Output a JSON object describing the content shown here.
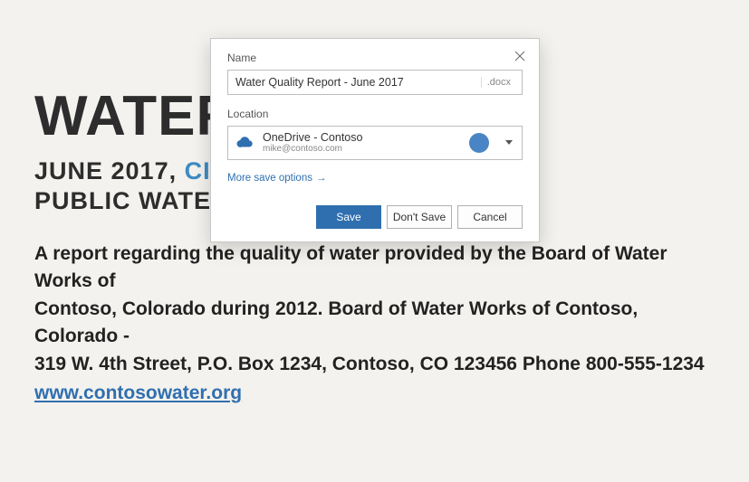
{
  "document": {
    "title": "WATER QUALITY",
    "subtitle1_prefix": "JUNE 2017, ",
    "subtitle1_city": "CITY OF CONTOSO",
    "subtitle2": "PUBLIC WATER SYSTEM",
    "body_line1": "A report regarding the quality of water provided by the Board of Water Works of",
    "body_line2": "Contoso, Colorado during 2012. Board of Water Works of Contoso, Colorado -",
    "body_line3": "319 W. 4th Street, P.O. Box 1234, Contoso, CO 123456 Phone 800-555-1234",
    "link": "www.contosowater.org"
  },
  "dialog": {
    "name_label": "Name",
    "name_value": "Water Quality Report - June 2017",
    "extension": ".docx",
    "location_label": "Location",
    "location_name": "OneDrive - Contoso",
    "location_email": "mike@contoso.com",
    "more_options": "More save options",
    "buttons": {
      "save": "Save",
      "dont_save": "Don't Save",
      "cancel": "Cancel"
    }
  }
}
